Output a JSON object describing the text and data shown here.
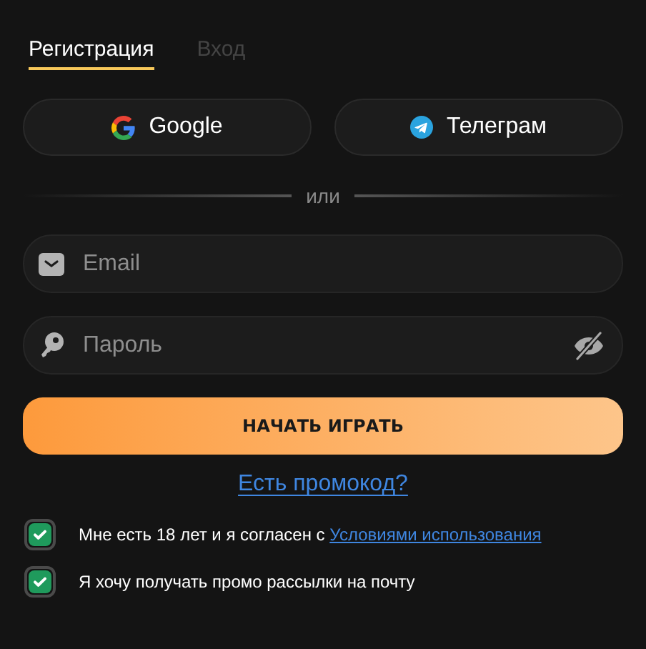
{
  "tabs": [
    {
      "label": "Регистрация",
      "selected": true
    },
    {
      "label": "Вход",
      "selected": false
    }
  ],
  "social_buttons": [
    {
      "kind": "google",
      "label": "Google"
    },
    {
      "kind": "telegram",
      "label": "Телеграм"
    }
  ],
  "divider": "или",
  "fields": [
    {
      "kind": "email",
      "placeholder": "Email"
    },
    {
      "kind": "password",
      "placeholder": "Пароль"
    }
  ],
  "submit": "НАЧАТЬ ИГРАТЬ",
  "promo_link": "Есть промокод?",
  "checkboxes": [
    {
      "text": "Мне есть 18 лет и я согласен с",
      "link": "Условиями использования",
      "checked": true
    },
    {
      "text": "Я хочу получать промо рассылки на почту",
      "checked": true
    }
  ]
}
